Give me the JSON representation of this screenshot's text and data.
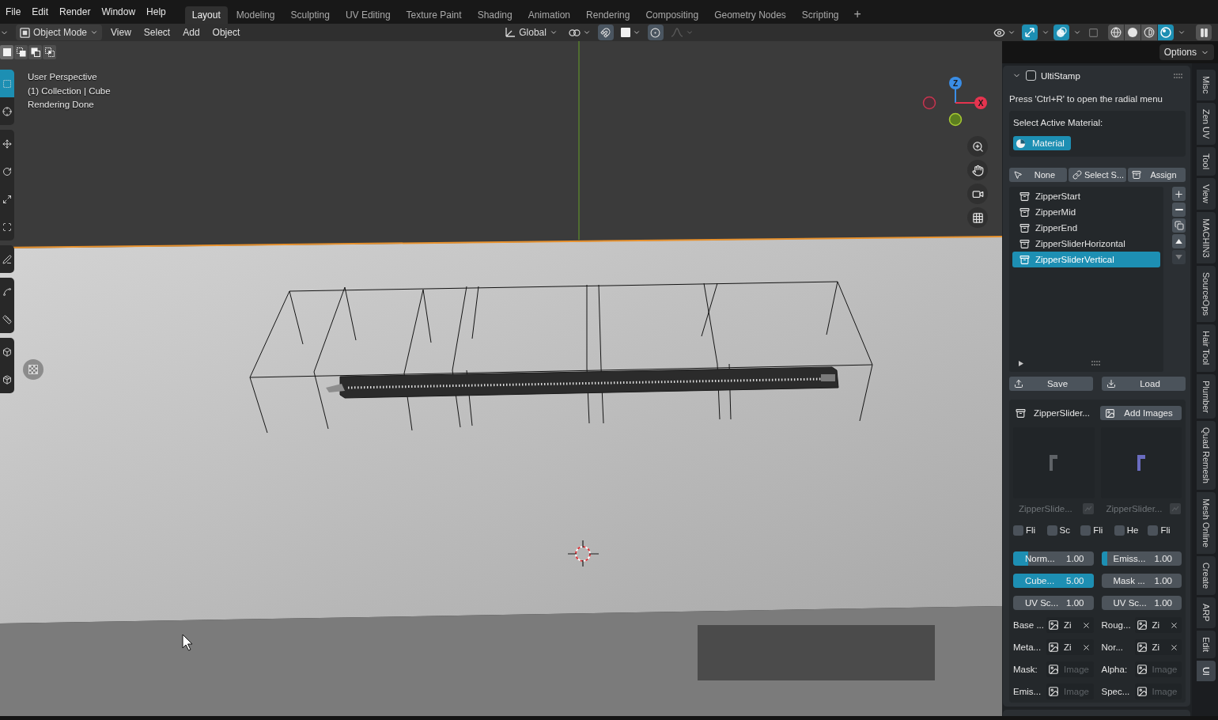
{
  "menu_bar": {
    "menus": [
      "File",
      "Edit",
      "Render",
      "Window",
      "Help"
    ],
    "workspace_tabs": [
      {
        "label": "Layout",
        "selected": true
      },
      {
        "label": "Modeling",
        "selected": false
      },
      {
        "label": "Sculpting",
        "selected": false
      },
      {
        "label": "UV Editing",
        "selected": false
      },
      {
        "label": "Texture Paint",
        "selected": false
      },
      {
        "label": "Shading",
        "selected": false
      },
      {
        "label": "Animation",
        "selected": false
      },
      {
        "label": "Rendering",
        "selected": false
      },
      {
        "label": "Compositing",
        "selected": false
      },
      {
        "label": "Geometry Nodes",
        "selected": false
      },
      {
        "label": "Scripting",
        "selected": false
      }
    ],
    "add_workspace": "+"
  },
  "viewport_header": {
    "mode": "Object Mode",
    "menus": [
      "View",
      "Select",
      "Add",
      "Object"
    ],
    "orientation": "Global",
    "toggles": [
      {
        "kind": "gizmo",
        "on": true
      },
      {
        "kind": "overlays",
        "on": true
      },
      {
        "kind": "xray",
        "on": false
      }
    ],
    "shading": [
      {
        "kind": "wireframe",
        "selected": false
      },
      {
        "kind": "solid",
        "selected": false
      },
      {
        "kind": "material",
        "selected": false
      },
      {
        "kind": "rendered",
        "selected": true
      }
    ]
  },
  "tool_settings": {
    "selection_modes": [
      {
        "kind": "set",
        "selected": true
      },
      {
        "kind": "extend",
        "selected": false
      },
      {
        "kind": "subtract",
        "selected": false
      },
      {
        "kind": "intersect",
        "selected": false
      }
    ],
    "options": "Options"
  },
  "toolbar": {
    "groups": [
      {
        "tools": [
          {
            "kind": "select",
            "selected": true
          },
          {
            "kind": "cursor",
            "selected": false
          }
        ]
      },
      {
        "tools": [
          {
            "kind": "move",
            "selected": false
          },
          {
            "kind": "rotate",
            "selected": false
          },
          {
            "kind": "scale",
            "selected": false
          },
          {
            "kind": "transform",
            "selected": false
          }
        ]
      },
      {
        "tools": [
          {
            "kind": "annotate",
            "selected": false
          }
        ]
      },
      {
        "tools": [
          {
            "kind": "curve",
            "selected": false
          },
          {
            "kind": "measure",
            "selected": false
          }
        ]
      },
      {
        "tools": [
          {
            "kind": "cube",
            "selected": false
          },
          {
            "kind": "extrude",
            "selected": false
          }
        ]
      }
    ]
  },
  "viewport": {
    "info": [
      "User Perspective",
      "(1) Collection | Cube",
      "Rendering Done"
    ],
    "gizmo_axes": [
      {
        "kind": "z",
        "label": "Z"
      },
      {
        "kind": "x",
        "label": "X"
      }
    ]
  },
  "n_panel": {
    "title": "UltiStamp",
    "expanded": true,
    "enabled": false,
    "hint": "Press 'Ctrl+R' to open the radial menu",
    "material_label": "Select Active Material:",
    "material": "Material",
    "actions": [
      {
        "kind": "pointer",
        "label": "None"
      },
      {
        "kind": "link",
        "label": "Select S..."
      },
      {
        "kind": "assign",
        "label": "Assign"
      }
    ],
    "stamps": [
      {
        "label": "ZipperStart",
        "selected": false
      },
      {
        "label": "ZipperMid",
        "selected": false
      },
      {
        "label": "ZipperEnd",
        "selected": false
      },
      {
        "label": "ZipperSliderHorizontal",
        "selected": false
      },
      {
        "label": "ZipperSliderVertical",
        "selected": true
      }
    ],
    "list_buttons": [
      {
        "kind": "add",
        "disabled": false
      },
      {
        "kind": "remove",
        "disabled": false
      },
      {
        "kind": "copy",
        "disabled": false
      },
      {
        "kind": "up",
        "disabled": false
      },
      {
        "kind": "down",
        "disabled": true
      }
    ],
    "file_buttons": [
      {
        "kind": "save",
        "label": "Save"
      },
      {
        "kind": "load",
        "label": "Load"
      }
    ],
    "stamp_name": "ZipperSlider...",
    "add_images": "Add Images",
    "images": [
      {
        "label": "ZipperSlide..."
      },
      {
        "label": "ZipperSlider..."
      }
    ],
    "toggles": [
      {
        "label": "Fli",
        "checked": false
      },
      {
        "label": "Sc",
        "checked": false
      },
      {
        "label": "Fli",
        "checked": false
      },
      {
        "label": "He",
        "checked": false
      },
      {
        "label": "Fli",
        "checked": false
      }
    ],
    "values": [
      {
        "kind": "slider",
        "label": "Norm...",
        "value": "1.00",
        "level": 0.19
      },
      {
        "kind": "slider",
        "label": "Emiss...",
        "value": "1.00",
        "level": 0.07
      },
      {
        "kind": "slider",
        "label": "Cube...",
        "value": "5.00",
        "level": 1
      },
      {
        "kind": "number",
        "label": "Mask ...",
        "value": "1.00"
      },
      {
        "kind": "number",
        "label": "UV Sc...",
        "value": "1.00"
      },
      {
        "kind": "number",
        "label": "UV Sc...",
        "value": "1.00"
      }
    ],
    "textures": [
      {
        "label": "Base ...",
        "value": "Zi"
      },
      {
        "label": "Roug...",
        "value": "Zi"
      },
      {
        "label": "Meta...",
        "value": "Zi"
      },
      {
        "label": "Nor...",
        "value": "Zi"
      },
      {
        "label": "Mask:",
        "placeholder": "Image"
      },
      {
        "label": "Alpha:",
        "placeholder": "Image"
      },
      {
        "label": "Emis...",
        "placeholder": "Image"
      },
      {
        "label": "Spec...",
        "placeholder": "Image"
      }
    ]
  },
  "sidebar_tabs": [
    {
      "label": "Misc",
      "selected": false
    },
    {
      "label": "Zen UV",
      "selected": false
    },
    {
      "label": "Tool",
      "selected": false
    },
    {
      "label": "View",
      "selected": false
    },
    {
      "label": "MACHIN3",
      "selected": false
    },
    {
      "label": "SourceOps",
      "selected": false
    },
    {
      "label": "Hair Tool",
      "selected": false
    },
    {
      "label": "Plumber",
      "selected": false
    },
    {
      "label": "Quad Remesh",
      "selected": false
    },
    {
      "label": "Mesh Online",
      "selected": false
    },
    {
      "label": "Create",
      "selected": false
    },
    {
      "label": "ARP",
      "selected": false
    },
    {
      "label": "Edit",
      "selected": false
    },
    {
      "label": "Ul",
      "selected": true
    }
  ]
}
